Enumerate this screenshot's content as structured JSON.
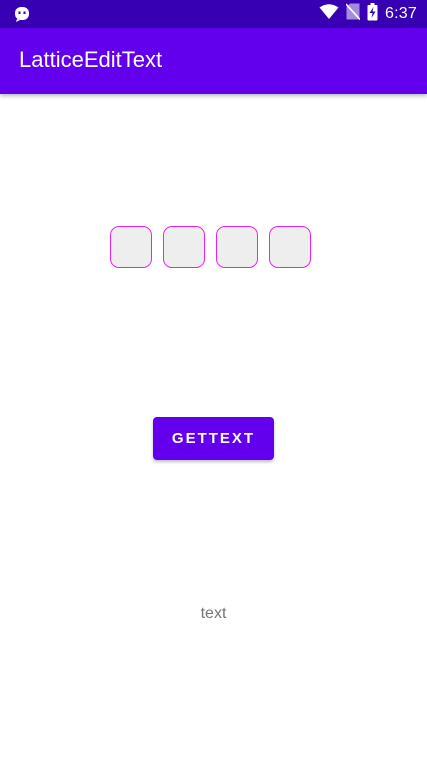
{
  "status_bar": {
    "time": "6:37",
    "icons": [
      "notification-icon",
      "wifi-icon",
      "no-sim-icon",
      "battery-charging-icon"
    ]
  },
  "app_bar": {
    "title": "LatticeEditText"
  },
  "lattice": {
    "cells": [
      "",
      "",
      "",
      ""
    ]
  },
  "get_button": {
    "label": "GETTEXT"
  },
  "result": {
    "text": "text"
  },
  "colors": {
    "status_bar": "#3700b3",
    "app_bar": "#6200ee",
    "cell_border": "#e625e6",
    "cell_fill": "#eeeeee",
    "result_text": "#757575"
  }
}
